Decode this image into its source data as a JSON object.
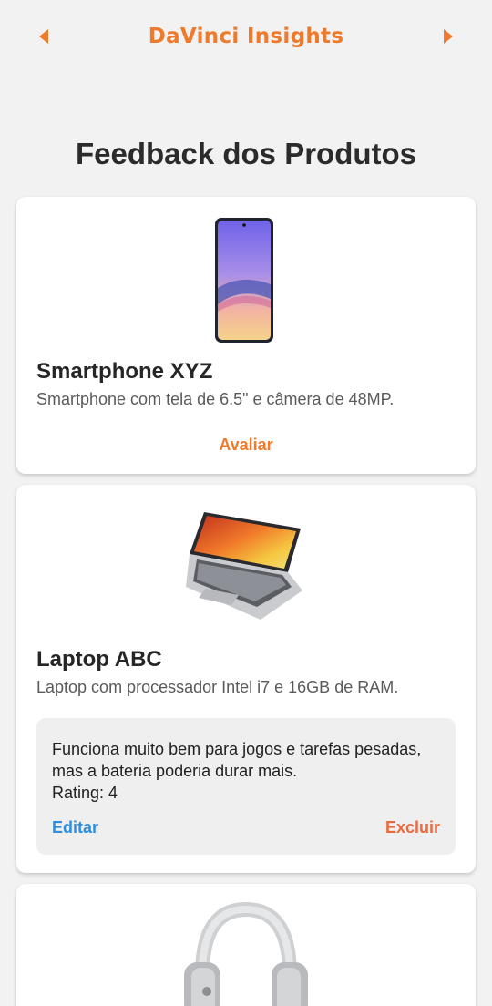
{
  "header": {
    "title": "DaVinci Insights",
    "prev_icon": "triangle-left-icon",
    "next_icon": "triangle-right-icon",
    "accent_color": "#ee7a2c"
  },
  "page": {
    "title": "Feedback dos Produtos"
  },
  "products": [
    {
      "name": "Smartphone XYZ",
      "description": "Smartphone com tela de 6.5\" e câmera de 48MP.",
      "image_icon": "smartphone-image",
      "action_label": "Avaliar"
    },
    {
      "name": "Laptop ABC",
      "description": "Laptop com processador Intel i7 e 16GB de RAM.",
      "image_icon": "laptop-image",
      "review": {
        "text": "Funciona muito bem para jogos e tarefas pesadas, mas a bateria poderia durar mais.",
        "rating_label": "Rating: 4",
        "rating_value": 4,
        "edit_label": "Editar",
        "delete_label": "Excluir",
        "edit_color": "#2f8ee0",
        "delete_color": "#ea6a3e"
      }
    },
    {
      "image_icon": "headphones-image"
    }
  ]
}
